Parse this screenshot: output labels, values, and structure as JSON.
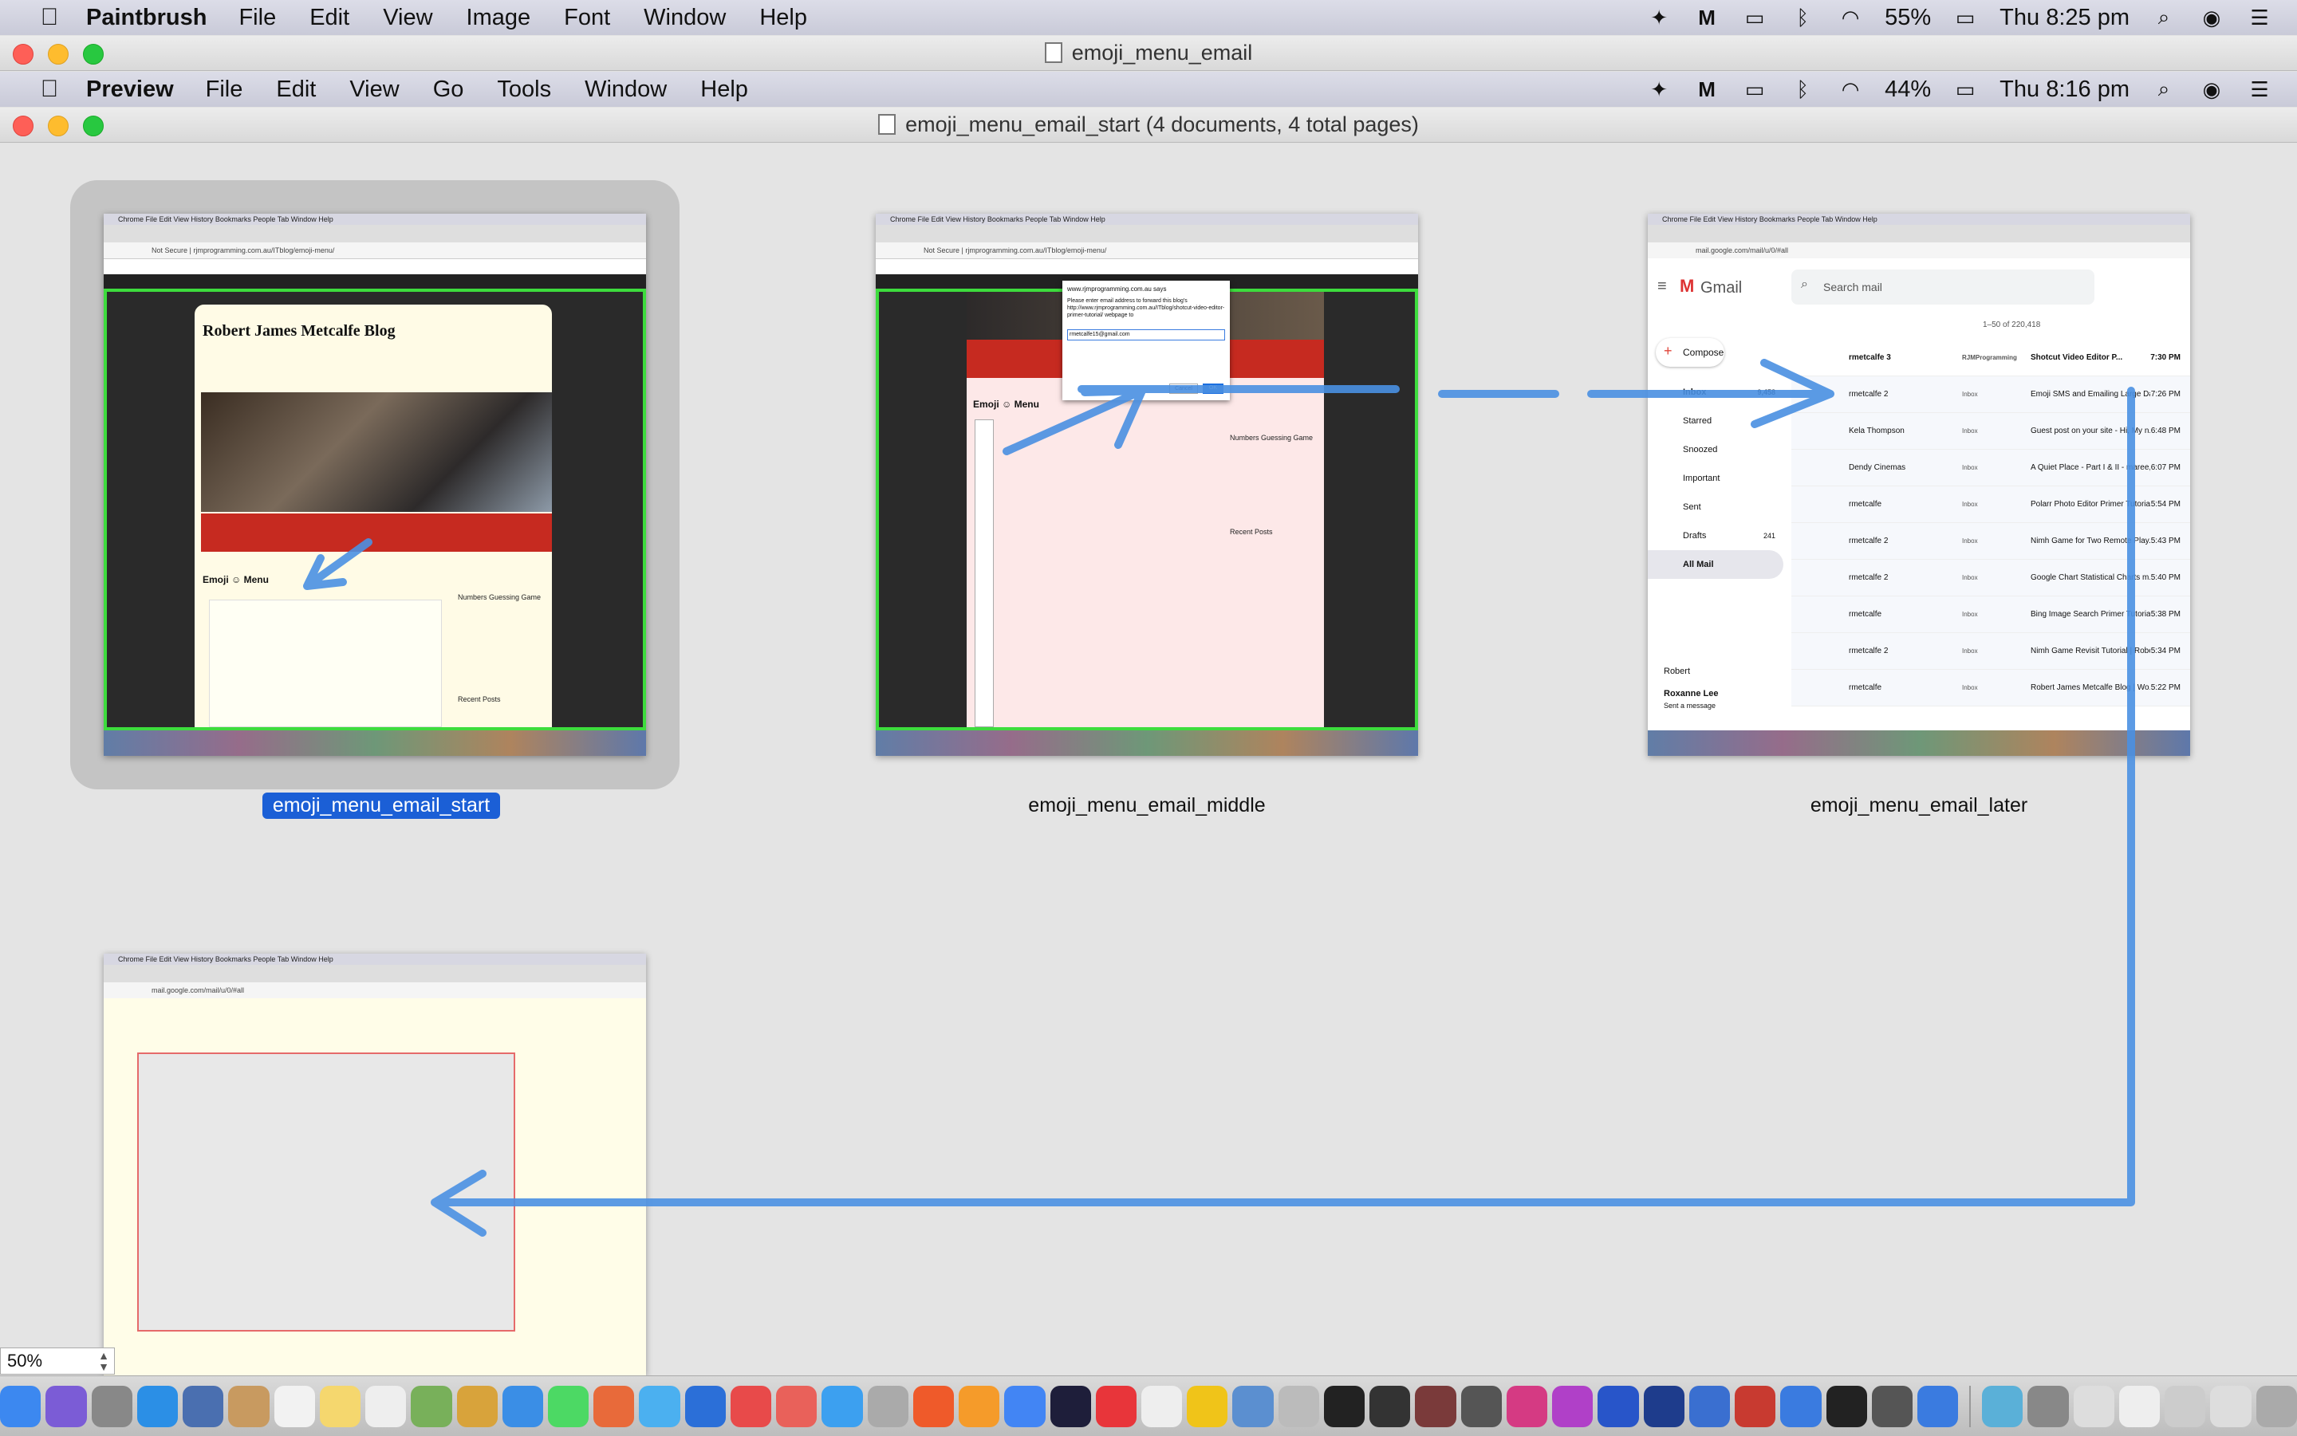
{
  "outer_menubar": {
    "app_name": "Paintbrush",
    "items": [
      "File",
      "Edit",
      "View",
      "Image",
      "Font",
      "Window",
      "Help"
    ],
    "battery": "55%",
    "clock": "Thu 8:25 pm"
  },
  "outer_window": {
    "title": "emoji_menu_email"
  },
  "inner_menubar": {
    "app_name": "Preview",
    "items": [
      "File",
      "Edit",
      "View",
      "Go",
      "Tools",
      "Window",
      "Help"
    ],
    "battery": "44%",
    "clock": "Thu 8:16 pm"
  },
  "preview_window": {
    "title": "emoji_menu_email_start (4 documents, 4 total pages)"
  },
  "documents": [
    {
      "filename": "emoji_menu_email_start",
      "selected": true,
      "blog_title": "Robert James Metcalfe Blog",
      "heading": "Emoji ☺ Menu",
      "widget_title": "Numbers Guessing Game",
      "recent_posts": "Recent Posts"
    },
    {
      "filename": "emoji_menu_email_middle",
      "selected": false,
      "dialog_title": "www.rjmprogramming.com.au says",
      "dialog_text": "Please enter email address to forward this blog's http://www.rjmprogramming.com.au/ITblog/shotcut-video-editor-primer-tutorial/ webpage to",
      "dialog_input": "rmetcalfe15@gmail.com",
      "cancel_label": "Cancel",
      "ok_label": "OK",
      "heading": "Emoji ☺ Menu",
      "widget_title": "Numbers Guessing Game",
      "recent_posts": "Recent Posts"
    },
    {
      "filename": "emoji_menu_email_later",
      "selected": false,
      "gmail_logo": "Gmail",
      "search_placeholder": "Search mail",
      "compose_label": "Compose",
      "pagination": "1–50 of 220,418",
      "folders": [
        {
          "label": "Inbox",
          "count": "9,458"
        },
        {
          "label": "Starred",
          "count": ""
        },
        {
          "label": "Snoozed",
          "count": ""
        },
        {
          "label": "Important",
          "count": ""
        },
        {
          "label": "Sent",
          "count": ""
        },
        {
          "label": "Drafts",
          "count": "241"
        },
        {
          "label": "All Mail",
          "count": ""
        }
      ],
      "user": "Robert",
      "contact_name": "Roxanne Lee",
      "contact_status": "Sent a message",
      "emails": [
        {
          "from": "rmetcalfe 3",
          "label": "RJMProgramming",
          "subject": "Shotcut Video Editor P...",
          "time": "7:30 PM"
        },
        {
          "from": "rmetcalfe 2",
          "label": "Inbox",
          "subject": "Emoji SMS and Emailing Large Da...",
          "time": "7:26 PM"
        },
        {
          "from": "Kela Thompson",
          "label": "Inbox",
          "subject": "Guest post on your site - Hi, My n...",
          "time": "6:48 PM"
        },
        {
          "from": "Dendy Cinemas",
          "label": "Inbox",
          "subject": "A Quiet Place - Part I & II - maree, ...",
          "time": "6:07 PM"
        },
        {
          "from": "rmetcalfe",
          "label": "Inbox",
          "subject": "Polarr Photo Editor Primer Tutoria...",
          "time": "5:54 PM"
        },
        {
          "from": "rmetcalfe 2",
          "label": "Inbox",
          "subject": "Nimh Game for Two Remote Play...",
          "time": "5:43 PM"
        },
        {
          "from": "rmetcalfe 2",
          "label": "Inbox",
          "subject": "Google Chart Statistical Charts m...",
          "time": "5:40 PM"
        },
        {
          "from": "rmetcalfe",
          "label": "Inbox",
          "subject": "Bing Image Search Primer Tutoria...",
          "time": "5:38 PM"
        },
        {
          "from": "rmetcalfe 2",
          "label": "Inbox",
          "subject": "Nimh Game Revisit Tutorial | Robe...",
          "time": "5:34 PM"
        },
        {
          "from": "rmetcalfe",
          "label": "Inbox",
          "subject": "Robert James Metcalfe Blog | Wo...",
          "time": "5:22 PM"
        }
      ]
    },
    {
      "filename": "",
      "selected": false
    }
  ],
  "zoom_level": "50%",
  "colors": {
    "selection": "#1b5fd6",
    "arrow": "#4a90e2",
    "site_border": "#3ddc3d",
    "nav_red": "#c62a20"
  }
}
